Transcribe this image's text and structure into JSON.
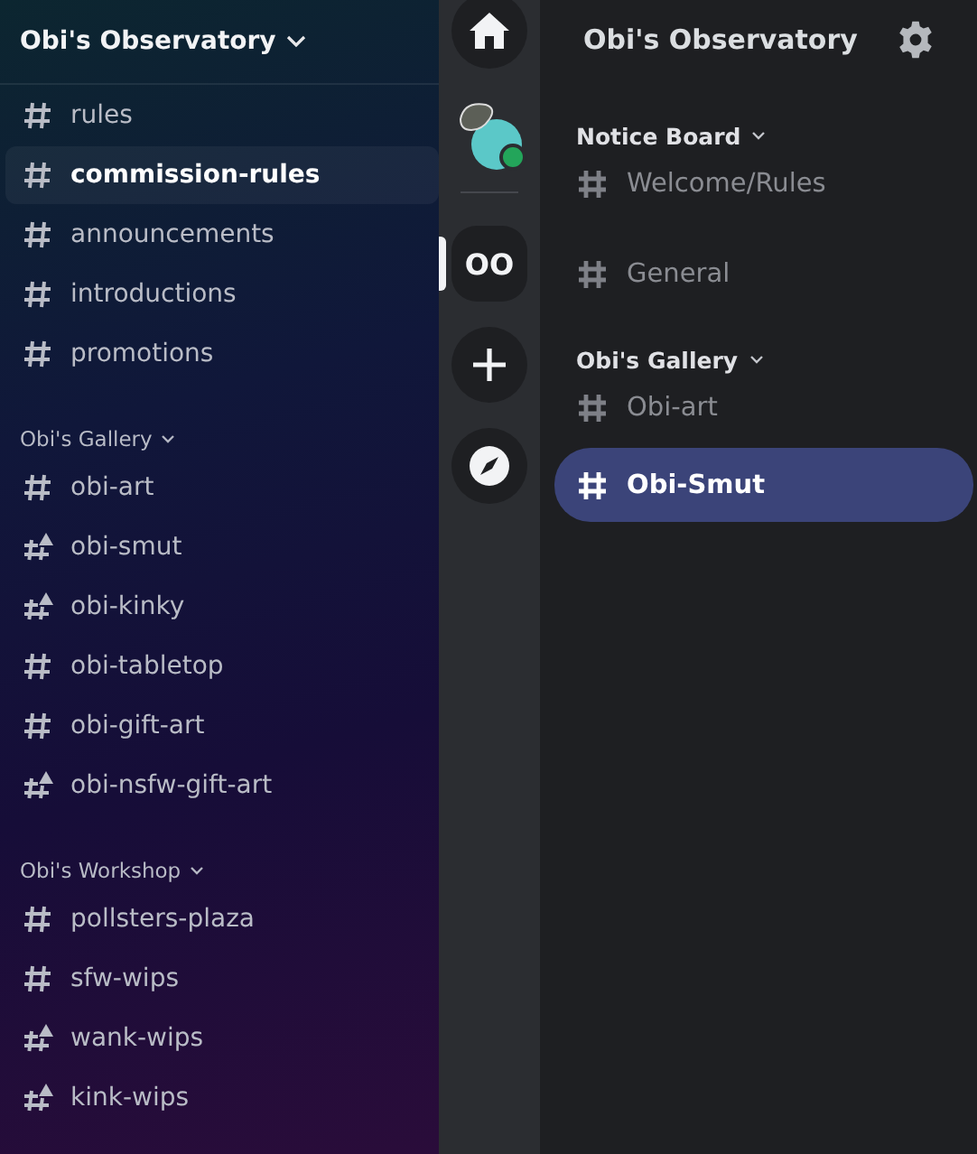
{
  "left_sidebar": {
    "title": "Obi's Observatory",
    "groups": [
      {
        "channels": [
          {
            "name": "rules",
            "kind": "text",
            "selected": false
          },
          {
            "name": "commission-rules",
            "kind": "text",
            "selected": true
          },
          {
            "name": "announcements",
            "kind": "text",
            "selected": false
          },
          {
            "name": "introductions",
            "kind": "text",
            "selected": false
          },
          {
            "name": "promotions",
            "kind": "text",
            "selected": false
          }
        ]
      },
      {
        "category": "Obi's Gallery",
        "channels": [
          {
            "name": "obi-art",
            "kind": "text",
            "selected": false
          },
          {
            "name": "obi-smut",
            "kind": "nsfw",
            "selected": false
          },
          {
            "name": "obi-kinky",
            "kind": "nsfw",
            "selected": false
          },
          {
            "name": "obi-tabletop",
            "kind": "text",
            "selected": false
          },
          {
            "name": "obi-gift-art",
            "kind": "text",
            "selected": false
          },
          {
            "name": "obi-nsfw-gift-art",
            "kind": "nsfw",
            "selected": false
          }
        ]
      },
      {
        "category": "Obi's Workshop",
        "channels": [
          {
            "name": "pollsters-plaza",
            "kind": "text",
            "selected": false
          },
          {
            "name": "sfw-wips",
            "kind": "text",
            "selected": false
          },
          {
            "name": "wank-wips",
            "kind": "nsfw",
            "selected": false
          },
          {
            "name": "kink-wips",
            "kind": "nsfw",
            "selected": false
          }
        ]
      }
    ]
  },
  "server_rail": [
    {
      "kind": "home",
      "selected": false
    },
    {
      "kind": "avatar",
      "selected": false
    },
    {
      "kind": "divider"
    },
    {
      "kind": "server",
      "label": "OO",
      "selected": true
    },
    {
      "kind": "add",
      "selected": false
    },
    {
      "kind": "explore",
      "selected": false
    }
  ],
  "right_panel": {
    "title": "Obi's Observatory",
    "groups": [
      {
        "category": "Notice Board",
        "channels": [
          {
            "name": "Welcome/Rules",
            "selected": false
          },
          {
            "name": "General",
            "selected": false
          }
        ]
      },
      {
        "category": "Obi's Gallery",
        "channels": [
          {
            "name": "Obi-art",
            "selected": false
          },
          {
            "name": "Obi-Smut",
            "selected": true
          }
        ]
      }
    ]
  }
}
